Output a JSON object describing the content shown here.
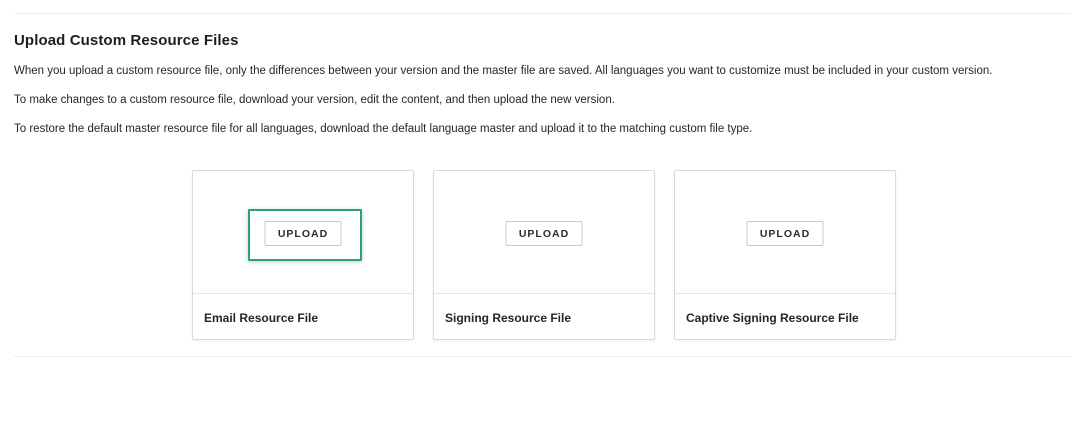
{
  "section": {
    "title": "Upload Custom Resource Files",
    "paragraphs": [
      "When you upload a custom resource file, only the differences between your version and the master file are saved. All languages you want to customize must be included in your custom version.",
      "To make changes to a custom resource file, download your version, edit the content, and then upload the new version.",
      "To restore the default master resource file for all languages, download the default language master and upload it to the matching custom file type."
    ]
  },
  "cards": [
    {
      "button_label": "UPLOAD",
      "label": "Email Resource File",
      "highlighted": true
    },
    {
      "button_label": "UPLOAD",
      "label": "Signing Resource File",
      "highlighted": false
    },
    {
      "button_label": "UPLOAD",
      "label": "Captive Signing Resource File",
      "highlighted": false
    }
  ],
  "colors": {
    "highlight": "#2e9e82"
  }
}
